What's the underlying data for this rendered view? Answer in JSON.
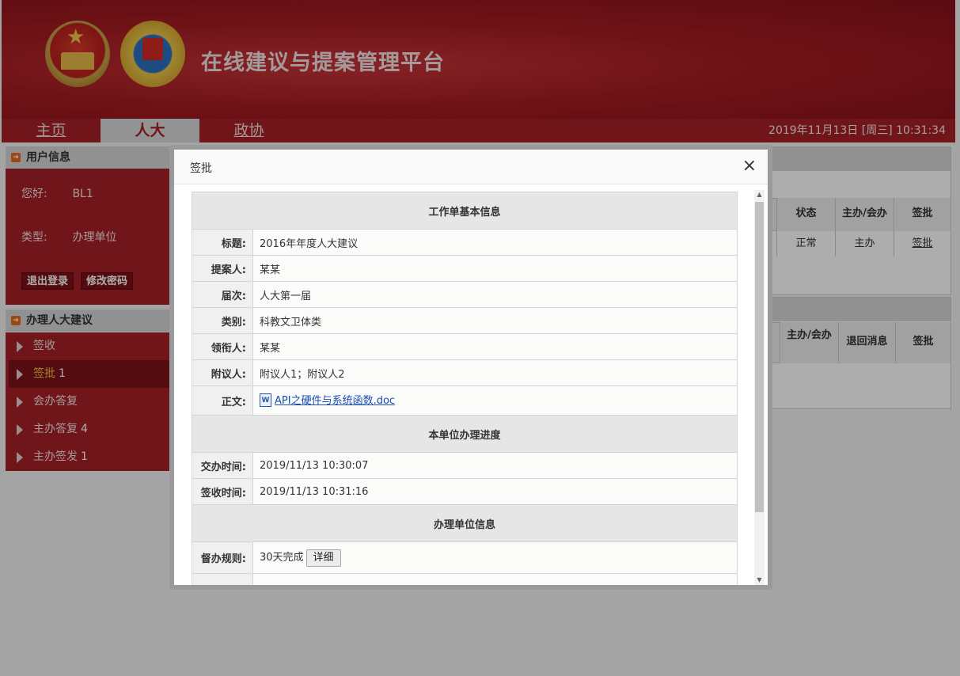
{
  "header": {
    "site_title": "在线建议与提案管理平台"
  },
  "nav": {
    "home": "主页",
    "npc": "人大",
    "cppcc": "政协",
    "datetime": "2019年11月13日  [周三]  10:31:34"
  },
  "user_panel": {
    "title": "用户信息",
    "greeting_label": "您好:",
    "greeting_value": "BL1",
    "type_label": "类型:",
    "type_value": "办理单位",
    "logout": "退出登录",
    "change_password": "修改密码"
  },
  "menu": {
    "title": "办理人大建议",
    "items": [
      {
        "label": "签收",
        "count": ""
      },
      {
        "label": "签批",
        "count": "1"
      },
      {
        "label": "会办答复",
        "count": ""
      },
      {
        "label": "主办答复",
        "count": "4"
      },
      {
        "label": "主办签发",
        "count": "1"
      }
    ]
  },
  "bg_table1": {
    "headers": [
      "状态",
      "主办/会办",
      "签批"
    ],
    "row": [
      "正常",
      "主办",
      "签批"
    ]
  },
  "bg_table2": {
    "headers": [
      "主办/会办",
      "退回消息",
      "签批"
    ]
  },
  "dialog": {
    "title": "签批",
    "close": "×",
    "sections": {
      "basic": "工作单基本信息",
      "progress": "本单位办理进度",
      "unit": "办理单位信息"
    },
    "fields": {
      "title_k": "标题:",
      "title_v": "2016年年度人大建议",
      "proposer_k": "提案人:",
      "proposer_v": "某某",
      "session_k": "届次:",
      "session_v": "人大第一届",
      "category_k": "类别:",
      "category_v": "科教文卫体类",
      "leader_k": "领衔人:",
      "leader_v": "某某",
      "cosigner_k": "附议人:",
      "cosigner_v": "附议人1；附议人2",
      "body_k": "正文:",
      "body_file": "API之硬件与系统函数.doc",
      "assign_k": "交办时间:",
      "assign_v": "2019/11/13 10:30:07",
      "receive_k": "签收时间:",
      "receive_v": "2019/11/13 10:31:16",
      "rule_k": "督办规则:",
      "rule_v": "30天完成",
      "rule_btn": "详细"
    }
  }
}
